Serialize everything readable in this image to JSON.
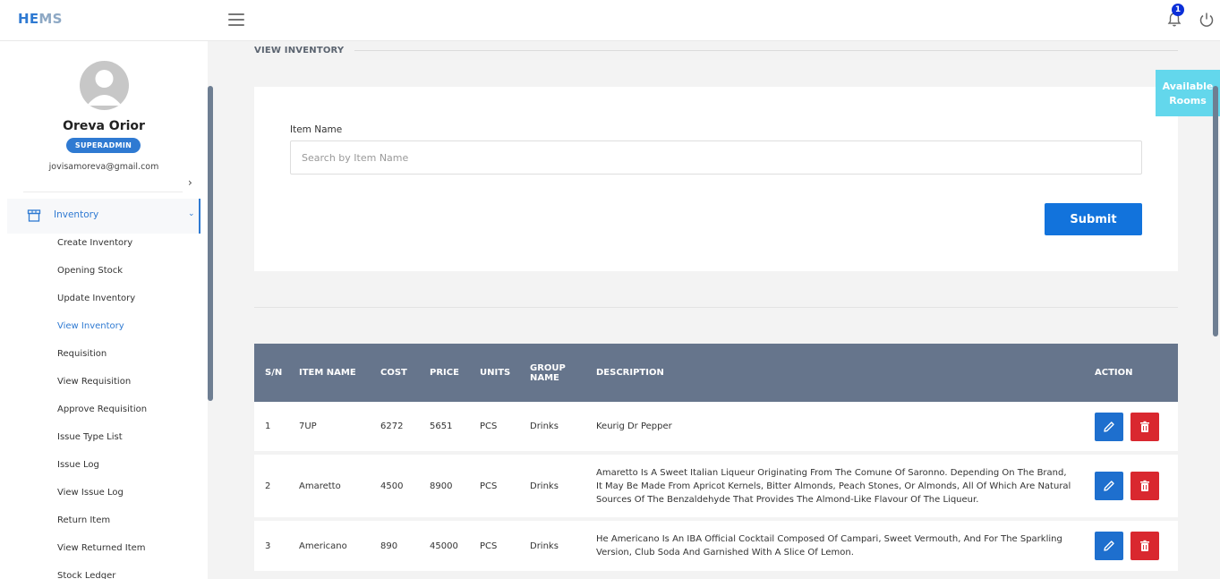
{
  "brand": {
    "part1": "HE",
    "part2": "MS"
  },
  "header": {
    "notification_count": "1"
  },
  "user": {
    "name": "Oreva Orior",
    "role": "SUPERADMIN",
    "email": "jovisamoreva@gmail.com"
  },
  "sidebar": {
    "active_section": "Inventory",
    "items": [
      {
        "label": "Create Inventory"
      },
      {
        "label": "Opening Stock"
      },
      {
        "label": "Update Inventory"
      },
      {
        "label": "View Inventory"
      },
      {
        "label": "Requisition"
      },
      {
        "label": "View Requisition"
      },
      {
        "label": "Approve Requisition"
      },
      {
        "label": "Issue Type List"
      },
      {
        "label": "Issue Log"
      },
      {
        "label": "View Issue Log"
      },
      {
        "label": "Return Item"
      },
      {
        "label": "View Returned Item"
      },
      {
        "label": "Stock Ledger"
      }
    ]
  },
  "page": {
    "title": "VIEW INVENTORY"
  },
  "form": {
    "label": "Item Name",
    "placeholder": "Search by Item Name",
    "value": "",
    "submit_label": "Submit"
  },
  "floating": {
    "available_rooms_line1": "Available",
    "available_rooms_line2": "Rooms"
  },
  "table": {
    "headers": {
      "sn": "S/N",
      "name": "ITEM NAME",
      "cost": "COST",
      "price": "PRICE",
      "units": "UNITS",
      "group_line1": "GROUP",
      "group_line2": "NAME",
      "description": "DESCRIPTION",
      "action": "ACTION"
    },
    "rows": [
      {
        "sn": "1",
        "name": "7UP",
        "cost": "6272",
        "price": "5651",
        "units": "PCS",
        "group": "Drinks",
        "description": "Keurig Dr Pepper"
      },
      {
        "sn": "2",
        "name": "Amaretto",
        "cost": "4500",
        "price": "8900",
        "units": "PCS",
        "group": "Drinks",
        "description": "Amaretto Is A Sweet Italian Liqueur Originating From The Comune Of Saronno. Depending On The Brand, It May Be Made From Apricot Kernels, Bitter Almonds, Peach Stones, Or Almonds, All Of Which Are Natural Sources Of The Benzaldehyde That Provides The Almond-Like Flavour Of The Liqueur."
      },
      {
        "sn": "3",
        "name": "Americano",
        "cost": "890",
        "price": "45000",
        "units": "PCS",
        "group": "Drinks",
        "description": "He Americano Is An IBA Official Cocktail Composed Of Campari, Sweet Vermouth, And For The Sparkling Version, Club Soda And Garnished With A Slice Of Lemon."
      }
    ]
  },
  "colors": {
    "accent": "#2f7ad2",
    "header_bg": "#66758c",
    "edit": "#1e6fce",
    "delete": "#d9282f",
    "rooms": "#63d7ec"
  }
}
